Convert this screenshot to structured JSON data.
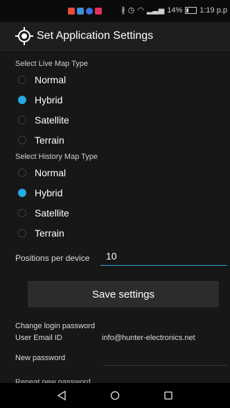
{
  "status_bar": {
    "notifications": [
      {
        "icon": "app-notification-icon",
        "color": "#e74c3c"
      },
      {
        "icon": "app-notification-icon",
        "color": "#3f8fe0"
      },
      {
        "icon": "app-notification-icon",
        "color": "#3f6fe0"
      },
      {
        "icon": "app-notification-icon",
        "color": "#e0315a"
      }
    ],
    "icons": [
      "bluetooth-icon",
      "alarm-icon",
      "wifi-icon",
      "signal-icon",
      "battery-icon"
    ],
    "battery": "14%",
    "time": "1:19 p.p"
  },
  "app_bar": {
    "icon": "location-target-icon",
    "title": "Set Application Settings"
  },
  "live_map": {
    "label": "Select Live Map Type",
    "options": [
      {
        "label": "Normal",
        "checked": false
      },
      {
        "label": "Hybrid",
        "checked": true
      },
      {
        "label": "Satellite",
        "checked": false
      },
      {
        "label": "Terrain",
        "checked": false
      }
    ]
  },
  "history_map": {
    "label": "Select History Map Type",
    "options": [
      {
        "label": "Normal",
        "checked": false
      },
      {
        "label": "Hybrid",
        "checked": true
      },
      {
        "label": "Satellite",
        "checked": false
      },
      {
        "label": "Terrain",
        "checked": false
      }
    ]
  },
  "positions": {
    "label": "Positions per device",
    "value": "10"
  },
  "save_button": {
    "label": "Save settings"
  },
  "password": {
    "heading": "Change login password",
    "email_label": "User Email ID",
    "email_value": "info@hunter-electronics.net",
    "new_password_label": "New password",
    "repeat_password_label": "Repeat new password"
  },
  "nav_bar": {
    "back": "back-triangle-icon",
    "home": "home-circle-icon",
    "recents": "recents-square-icon"
  },
  "colors": {
    "accent": "#27a9e3",
    "background": "#171717",
    "button": "#2c2c2c"
  }
}
